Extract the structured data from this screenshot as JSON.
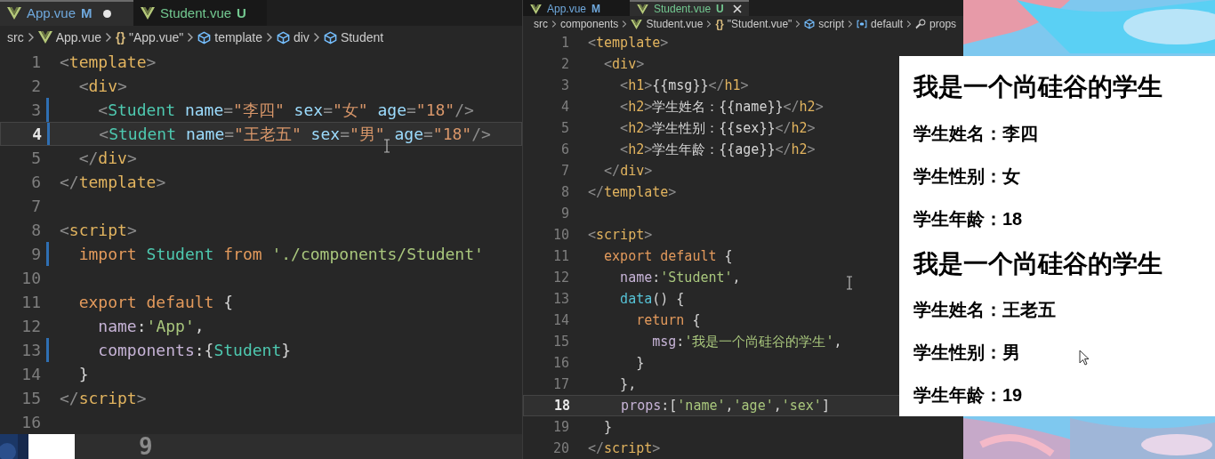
{
  "left_editor": {
    "tabs": [
      {
        "label": "App.vue",
        "status": "M",
        "color": "#6fa8dc",
        "selected": true,
        "dirty": true,
        "close_button": false
      },
      {
        "label": "Student.vue",
        "status": "U",
        "color": "#73c991",
        "selected": false,
        "dirty": false,
        "close_button": false
      }
    ],
    "breadcrumb": [
      {
        "kind": "text",
        "label": "src"
      },
      {
        "kind": "vue",
        "label": "App.vue"
      },
      {
        "kind": "braces",
        "icon": "{}",
        "label": "\"App.vue\""
      },
      {
        "kind": "element",
        "label": "template"
      },
      {
        "kind": "element",
        "label": "div"
      },
      {
        "kind": "element",
        "label": "Student"
      }
    ],
    "lines": [
      {
        "no": "1",
        "current": false,
        "changed": false,
        "tokens": [
          {
            "kind": "punct",
            "text": "<"
          },
          {
            "kind": "tag",
            "text": "template"
          },
          {
            "kind": "punct",
            "text": ">"
          }
        ]
      },
      {
        "no": "2",
        "current": false,
        "changed": false,
        "tokens": [
          {
            "kind": "punct",
            "text": "  <"
          },
          {
            "kind": "tag",
            "text": "div"
          },
          {
            "kind": "punct",
            "text": ">"
          }
        ]
      },
      {
        "no": "3",
        "current": false,
        "changed": true,
        "tokens": [
          {
            "kind": "punct",
            "text": "    <"
          },
          {
            "kind": "component",
            "text": "Student"
          },
          {
            "kind": "attr",
            "text": " name"
          },
          {
            "kind": "punct",
            "text": "="
          },
          {
            "kind": "value",
            "text": "\"李四\""
          },
          {
            "kind": "attr",
            "text": " sex"
          },
          {
            "kind": "punct",
            "text": "="
          },
          {
            "kind": "value",
            "text": "\"女\""
          },
          {
            "kind": "attr",
            "text": " age"
          },
          {
            "kind": "punct",
            "text": "="
          },
          {
            "kind": "value",
            "text": "\"18\""
          },
          {
            "kind": "punct",
            "text": "/>"
          }
        ]
      },
      {
        "no": "4",
        "current": true,
        "changed": true,
        "tokens": [
          {
            "kind": "punct",
            "text": "    <"
          },
          {
            "kind": "component",
            "text": "Student"
          },
          {
            "kind": "attr",
            "text": " name"
          },
          {
            "kind": "punct",
            "text": "="
          },
          {
            "kind": "value",
            "text": "\"王老五\""
          },
          {
            "kind": "attr",
            "text": " sex"
          },
          {
            "kind": "punct",
            "text": "="
          },
          {
            "kind": "value",
            "text": "\"男\""
          },
          {
            "kind": "attr",
            "text": " age"
          },
          {
            "kind": "punct",
            "text": "="
          },
          {
            "kind": "value",
            "text": "\"18\""
          },
          {
            "kind": "punct",
            "text": "/>"
          }
        ]
      },
      {
        "no": "5",
        "current": false,
        "changed": false,
        "tokens": [
          {
            "kind": "punct",
            "text": "  </"
          },
          {
            "kind": "tag",
            "text": "div"
          },
          {
            "kind": "punct",
            "text": ">"
          }
        ]
      },
      {
        "no": "6",
        "current": false,
        "changed": false,
        "tokens": [
          {
            "kind": "punct",
            "text": "</"
          },
          {
            "kind": "tag",
            "text": "template"
          },
          {
            "kind": "punct",
            "text": ">"
          }
        ]
      },
      {
        "no": "7",
        "current": false,
        "changed": false
      },
      {
        "no": "8",
        "current": false,
        "changed": false,
        "tokens": [
          {
            "kind": "punct",
            "text": "<"
          },
          {
            "kind": "tag",
            "text": "script"
          },
          {
            "kind": "punct",
            "text": ">"
          }
        ]
      },
      {
        "no": "9",
        "current": false,
        "changed": true,
        "tokens": [
          {
            "kind": "keyword",
            "text": "  import"
          },
          {
            "kind": "component",
            "text": " Student"
          },
          {
            "kind": "keyword",
            "text": " from"
          },
          {
            "kind": "string",
            "text": " './components/Student'"
          }
        ]
      },
      {
        "no": "10",
        "current": false,
        "changed": false
      },
      {
        "no": "11",
        "current": false,
        "changed": false,
        "tokens": [
          {
            "kind": "keyword",
            "text": "  export default"
          },
          {
            "kind": "text",
            "text": " {"
          }
        ]
      },
      {
        "no": "12",
        "current": false,
        "changed": false,
        "tokens": [
          {
            "kind": "prop",
            "text": "    name"
          },
          {
            "kind": "text",
            "text": ":"
          },
          {
            "kind": "string",
            "text": "'App'"
          },
          {
            "kind": "text",
            "text": ","
          }
        ]
      },
      {
        "no": "13",
        "current": false,
        "changed": true,
        "tokens": [
          {
            "kind": "prop",
            "text": "    components"
          },
          {
            "kind": "text",
            "text": ":{"
          },
          {
            "kind": "component",
            "text": "Student"
          },
          {
            "kind": "text",
            "text": "}"
          }
        ]
      },
      {
        "no": "14",
        "current": false,
        "changed": false,
        "tokens": [
          {
            "kind": "text",
            "text": "  }"
          }
        ]
      },
      {
        "no": "15",
        "current": false,
        "changed": false,
        "tokens": [
          {
            "kind": "punct",
            "text": "</"
          },
          {
            "kind": "tag",
            "text": "script"
          },
          {
            "kind": "punct",
            "text": ">"
          }
        ]
      },
      {
        "no": "16",
        "current": false,
        "changed": false
      }
    ]
  },
  "right_editor": {
    "tabs": [
      {
        "label": "App.vue",
        "status": "M",
        "color": "#6fa8dc",
        "selected": false,
        "dirty": false,
        "close_button": false
      },
      {
        "label": "Student.vue",
        "status": "U",
        "color": "#73c991",
        "selected": true,
        "dirty": false,
        "close_button": true
      }
    ],
    "breadcrumb": [
      {
        "kind": "text",
        "label": "src"
      },
      {
        "kind": "text",
        "label": "components"
      },
      {
        "kind": "vue",
        "label": "Student.vue"
      },
      {
        "kind": "braces",
        "icon": "{}",
        "label": "\"Student.vue\""
      },
      {
        "kind": "element",
        "label": "script"
      },
      {
        "kind": "module",
        "label": "default"
      },
      {
        "kind": "property",
        "label": "props"
      }
    ],
    "lines": [
      {
        "no": "1",
        "current": false,
        "changed": false,
        "tokens": [
          {
            "kind": "punct",
            "text": "<"
          },
          {
            "kind": "tag",
            "text": "template"
          },
          {
            "kind": "punct",
            "text": ">"
          }
        ]
      },
      {
        "no": "2",
        "current": false,
        "changed": false,
        "tokens": [
          {
            "kind": "punct",
            "text": "  <"
          },
          {
            "kind": "tag",
            "text": "div"
          },
          {
            "kind": "punct",
            "text": ">"
          }
        ]
      },
      {
        "no": "3",
        "current": false,
        "changed": false,
        "tokens": [
          {
            "kind": "punct",
            "text": "    <"
          },
          {
            "kind": "tag",
            "text": "h1"
          },
          {
            "kind": "punct",
            "text": ">"
          },
          {
            "kind": "text",
            "text": "{{msg}}"
          },
          {
            "kind": "punct",
            "text": "</"
          },
          {
            "kind": "tag",
            "text": "h1"
          },
          {
            "kind": "punct",
            "text": ">"
          }
        ]
      },
      {
        "no": "4",
        "current": false,
        "changed": false,
        "tokens": [
          {
            "kind": "punct",
            "text": "    <"
          },
          {
            "kind": "tag",
            "text": "h2"
          },
          {
            "kind": "punct",
            "text": ">"
          },
          {
            "kind": "text",
            "text": "学生姓名：{{name}}"
          },
          {
            "kind": "punct",
            "text": "</"
          },
          {
            "kind": "tag",
            "text": "h2"
          },
          {
            "kind": "punct",
            "text": ">"
          }
        ]
      },
      {
        "no": "5",
        "current": false,
        "changed": false,
        "tokens": [
          {
            "kind": "punct",
            "text": "    <"
          },
          {
            "kind": "tag",
            "text": "h2"
          },
          {
            "kind": "punct",
            "text": ">"
          },
          {
            "kind": "text",
            "text": "学生性别：{{sex}}"
          },
          {
            "kind": "punct",
            "text": "</"
          },
          {
            "kind": "tag",
            "text": "h2"
          },
          {
            "kind": "punct",
            "text": ">"
          }
        ]
      },
      {
        "no": "6",
        "current": false,
        "changed": false,
        "tokens": [
          {
            "kind": "punct",
            "text": "    <"
          },
          {
            "kind": "tag",
            "text": "h2"
          },
          {
            "kind": "punct",
            "text": ">"
          },
          {
            "kind": "text",
            "text": "学生年龄：{{age}}"
          },
          {
            "kind": "punct",
            "text": "</"
          },
          {
            "kind": "tag",
            "text": "h2"
          },
          {
            "kind": "punct",
            "text": ">"
          }
        ]
      },
      {
        "no": "7",
        "current": false,
        "changed": false,
        "tokens": [
          {
            "kind": "punct",
            "text": "  </"
          },
          {
            "kind": "tag",
            "text": "div"
          },
          {
            "kind": "punct",
            "text": ">"
          }
        ]
      },
      {
        "no": "8",
        "current": false,
        "changed": false,
        "tokens": [
          {
            "kind": "punct",
            "text": "</"
          },
          {
            "kind": "tag",
            "text": "template"
          },
          {
            "kind": "punct",
            "text": ">"
          }
        ]
      },
      {
        "no": "9",
        "current": false,
        "changed": false
      },
      {
        "no": "10",
        "current": false,
        "changed": false,
        "tokens": [
          {
            "kind": "punct",
            "text": "<"
          },
          {
            "kind": "tag",
            "text": "script"
          },
          {
            "kind": "punct",
            "text": ">"
          }
        ]
      },
      {
        "no": "11",
        "current": false,
        "changed": false,
        "tokens": [
          {
            "kind": "keyword",
            "text": "  export default"
          },
          {
            "kind": "text",
            "text": " {"
          }
        ]
      },
      {
        "no": "12",
        "current": false,
        "changed": false,
        "tokens": [
          {
            "kind": "prop",
            "text": "    name"
          },
          {
            "kind": "text",
            "text": ":"
          },
          {
            "kind": "string",
            "text": "'Student'"
          },
          {
            "kind": "text",
            "text": ","
          }
        ]
      },
      {
        "no": "13",
        "current": false,
        "changed": false,
        "tokens": [
          {
            "kind": "func",
            "text": "    data"
          },
          {
            "kind": "text",
            "text": "() {"
          }
        ]
      },
      {
        "no": "14",
        "current": false,
        "changed": false,
        "tokens": [
          {
            "kind": "keyword",
            "text": "      return"
          },
          {
            "kind": "text",
            "text": " {"
          }
        ]
      },
      {
        "no": "15",
        "current": false,
        "changed": false,
        "tokens": [
          {
            "kind": "prop",
            "text": "        msg"
          },
          {
            "kind": "text",
            "text": ":"
          },
          {
            "kind": "string",
            "text": "'我是一个尚硅谷的学生'"
          },
          {
            "kind": "text",
            "text": ","
          }
        ]
      },
      {
        "no": "16",
        "current": false,
        "changed": false,
        "tokens": [
          {
            "kind": "text",
            "text": "      }"
          }
        ]
      },
      {
        "no": "17",
        "current": false,
        "changed": false,
        "tokens": [
          {
            "kind": "text",
            "text": "    },"
          }
        ]
      },
      {
        "no": "18",
        "current": true,
        "changed": false,
        "tokens": [
          {
            "kind": "prop",
            "text": "    props"
          },
          {
            "kind": "text",
            "text": ":["
          },
          {
            "kind": "string",
            "text": "'name'"
          },
          {
            "kind": "text",
            "text": ","
          },
          {
            "kind": "string",
            "text": "'age'"
          },
          {
            "kind": "text",
            "text": ","
          },
          {
            "kind": "string",
            "text": "'sex'"
          },
          {
            "kind": "text",
            "text": "]"
          }
        ]
      },
      {
        "no": "19",
        "current": false,
        "changed": false,
        "tokens": [
          {
            "kind": "text",
            "text": "  }"
          }
        ]
      },
      {
        "no": "20",
        "current": false,
        "changed": false,
        "tokens": [
          {
            "kind": "punct",
            "text": "</"
          },
          {
            "kind": "tag",
            "text": "script"
          },
          {
            "kind": "punct",
            "text": ">"
          }
        ]
      }
    ]
  },
  "browser": {
    "items": [
      {
        "kind": "h1",
        "text": "我是一个尚硅谷的学生"
      },
      {
        "kind": "h2",
        "text": "学生姓名：李四"
      },
      {
        "kind": "h2",
        "text": "学生性别：女"
      },
      {
        "kind": "h2",
        "text": "学生年龄：18"
      },
      {
        "kind": "h1",
        "text": "我是一个尚硅谷的学生"
      },
      {
        "kind": "h2",
        "text": "学生姓名：王老五"
      },
      {
        "kind": "h2",
        "text": "学生性别：男"
      },
      {
        "kind": "h2",
        "text": "学生年龄：19"
      }
    ]
  },
  "bottom_strip": {
    "text": "9"
  }
}
